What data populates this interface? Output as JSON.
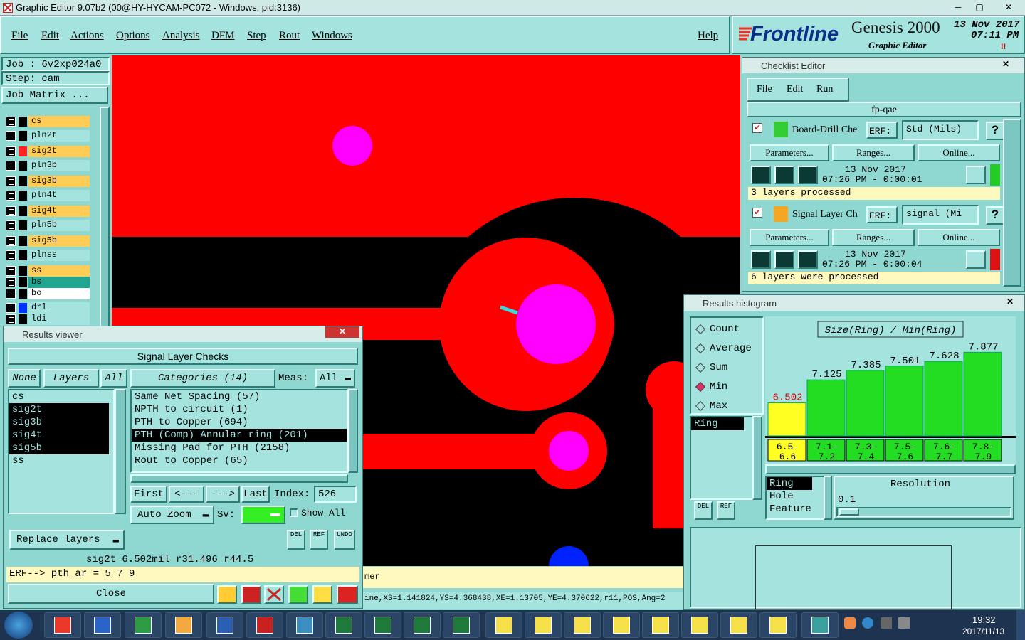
{
  "window": {
    "title": "Graphic Editor 9.07b2 (00@HY-HYCAM-PC072 - Windows, pid:3136)"
  },
  "menu": [
    "File",
    "Edit",
    "Actions",
    "Options",
    "Analysis",
    "DFM",
    "Step",
    "Rout",
    "Windows"
  ],
  "help_label": "Help",
  "brand": {
    "logo": "Frontline",
    "product": "Genesis 2000",
    "subtitle": "Graphic Editor",
    "date": "13 Nov 2017",
    "time": "07:11 PM",
    "indicator": "!!"
  },
  "job": {
    "job_label": "Job : 6v2xp024a0",
    "step_label": "Step: cam",
    "matrix_button": "Job Matrix ..."
  },
  "layers": [
    {
      "name": "cs",
      "color": "#ffcc55"
    },
    {
      "name": "pln2t",
      "color": "#a4e3de"
    },
    {
      "name": "sig2t",
      "color": "#ffcc55"
    },
    {
      "name": "pln3b",
      "color": "#a4e3de"
    },
    {
      "name": "sig3b",
      "color": "#ffcc55"
    },
    {
      "name": "pln4t",
      "color": "#a4e3de"
    },
    {
      "name": "sig4t",
      "color": "#ffcc55"
    },
    {
      "name": "pln5b",
      "color": "#a4e3de"
    },
    {
      "name": "sig5b",
      "color": "#ffcc55"
    },
    {
      "name": "plnss",
      "color": "#a4e3de"
    },
    {
      "name": "ss",
      "color": "#ffcc55"
    },
    {
      "name": "bs",
      "color": "#1fa590"
    },
    {
      "name": "bo",
      "color": "#ffffff"
    },
    {
      "name": "drl",
      "color": "#a4e3de"
    },
    {
      "name": "ldi",
      "color": "#a4e3de"
    }
  ],
  "checklist": {
    "title": "Checklist Editor",
    "menu": [
      "File",
      "Edit",
      "Run"
    ],
    "name": "fp-qae",
    "checks": [
      {
        "name": "Board-Drill Che",
        "erf_label": "ERF:",
        "erf_value": "Std (Mils)",
        "params": "Parameters...",
        "ranges": "Ranges...",
        "online": "Online...",
        "date": "13 Nov 2017",
        "time": "07:26 PM - 0:00:01",
        "status": "3 layers processed",
        "status_color": "#22cc22"
      },
      {
        "name": "Signal Layer Ch",
        "erf_label": "ERF:",
        "erf_value": "signal (Mi",
        "params": "Parameters...",
        "ranges": "Ranges...",
        "online": "Online...",
        "date": "13 Nov 2017",
        "time": "07:26 PM - 0:00:04",
        "status": "6 layers were processed",
        "status_color": "#dd1111"
      }
    ],
    "help": "?"
  },
  "histogram": {
    "title": "Results histogram",
    "modes": [
      "Count",
      "Average",
      "Sum",
      "Min",
      "Max"
    ],
    "selected_mode": "Min",
    "list": [
      "Ring"
    ],
    "feature_list": [
      "Ring",
      "Hole",
      "Feature"
    ],
    "resolution_label": "Resolution",
    "resolution_value": "0.1",
    "del_label": "DEL",
    "ref_label": "REF"
  },
  "chart_data": {
    "type": "bar",
    "title": "Size(Ring) / Min(Ring)",
    "categories": [
      "6.5-6.6",
      "7.1-7.2",
      "7.3-7.4",
      "7.5-7.6",
      "7.6-7.7",
      "7.8-7.9"
    ],
    "values": [
      6.502,
      7.125,
      7.385,
      7.501,
      7.628,
      7.877
    ],
    "value_labels": [
      "6.502",
      "7.125",
      "7.385",
      "7.501",
      "7.628",
      "7.877"
    ],
    "colors": [
      "#ffff22",
      "#22dd22",
      "#22dd22",
      "#22dd22",
      "#22dd22",
      "#22dd22"
    ],
    "ylim": [
      5.6,
      8.0
    ]
  },
  "results": {
    "title": "Results viewer",
    "heading": "Signal Layer Checks",
    "none_btn": "None",
    "layers_btn": "Layers",
    "all_btn": "All",
    "layer_list": [
      {
        "name": "cs",
        "sel": false
      },
      {
        "name": "sig2t",
        "sel": true
      },
      {
        "name": "sig3b",
        "sel": true
      },
      {
        "name": "sig4t",
        "sel": true
      },
      {
        "name": "sig5b",
        "sel": true
      },
      {
        "name": "ss",
        "sel": false
      }
    ],
    "categories_btn": "Categories (14)",
    "meas_label": "Meas:",
    "meas_value": "All",
    "categories": [
      {
        "name": "Same Net Spacing (57)",
        "sel": false
      },
      {
        "name": "NPTH to circuit (1)",
        "sel": false
      },
      {
        "name": "PTH to Copper (694)",
        "sel": false
      },
      {
        "name": "PTH (Comp) Annular ring (201)",
        "sel": true
      },
      {
        "name": "Missing Pad for PTH (2158)",
        "sel": false
      },
      {
        "name": "Rout to Copper (65)",
        "sel": false
      }
    ],
    "first": "First",
    "prev": "<---",
    "next": "--->",
    "last": "Last",
    "index_label": "Index:",
    "index_value": "526",
    "autozoom": "Auto Zoom",
    "sv_label": "Sv:",
    "show_all": "Show All",
    "replace": "Replace layers",
    "measure": "sig2t 6.502mil  r31.496  r44.5",
    "erf_line": "ERF--> pth_ar = 5 7 9",
    "close": "Close",
    "del": "DEL",
    "ref": "REF",
    "undo": "UNDO"
  },
  "status": {
    "line1": "mer",
    "line2": "ine,XS=1.141824,YS=4.368438,XE=1.13705,YE=4.370622,r11,POS,Ang=2"
  },
  "clock": {
    "time": "19:32",
    "date": "2017/11/13"
  }
}
